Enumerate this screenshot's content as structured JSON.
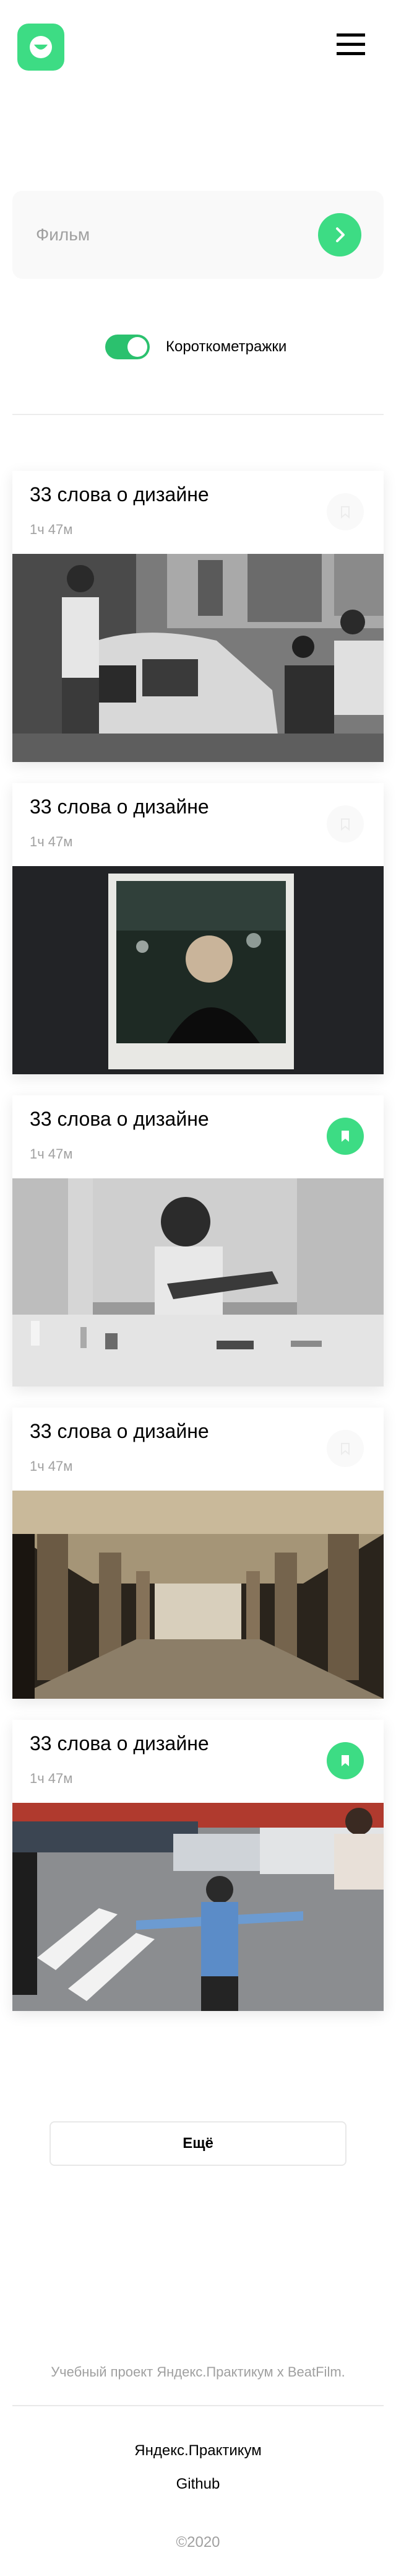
{
  "search": {
    "placeholder": "Фильм"
  },
  "filter": {
    "label": "Короткометражки",
    "checked": true
  },
  "movies": [
    {
      "title": "33 слова о дизайне",
      "duration": "1ч 47м",
      "saved": false
    },
    {
      "title": "33 слова о дизайне",
      "duration": "1ч 47м",
      "saved": false
    },
    {
      "title": "33 слова о дизайне",
      "duration": "1ч 47м",
      "saved": true
    },
    {
      "title": "33 слова о дизайне",
      "duration": "1ч 47м",
      "saved": false
    },
    {
      "title": "33 слова о дизайне",
      "duration": "1ч 47м",
      "saved": true
    }
  ],
  "more_label": "Ещё",
  "footer": {
    "text": "Учебный проект Яндекс.Практикум х BeatFilm.",
    "links": [
      "Яндекс.Практикум",
      "Github"
    ],
    "copyright": "©2020"
  },
  "colors": {
    "accent": "#3ddc84",
    "toggle": "#2bc16e",
    "muted": "#a0a0a0"
  },
  "icons": {
    "logo": "smile-logo-icon",
    "menu": "burger-menu-icon",
    "search": "chevron-right-icon",
    "bookmark": "bookmark-icon"
  }
}
